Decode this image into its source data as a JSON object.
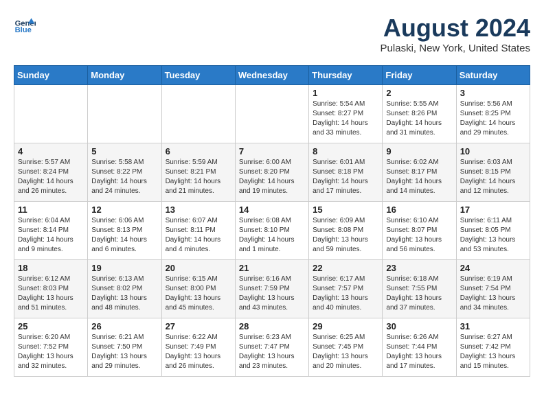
{
  "header": {
    "logo_line1": "General",
    "logo_line2": "Blue",
    "month": "August 2024",
    "location": "Pulaski, New York, United States"
  },
  "days_of_week": [
    "Sunday",
    "Monday",
    "Tuesday",
    "Wednesday",
    "Thursday",
    "Friday",
    "Saturday"
  ],
  "weeks": [
    [
      {
        "day": "",
        "content": ""
      },
      {
        "day": "",
        "content": ""
      },
      {
        "day": "",
        "content": ""
      },
      {
        "day": "",
        "content": ""
      },
      {
        "day": "1",
        "content": "Sunrise: 5:54 AM\nSunset: 8:27 PM\nDaylight: 14 hours\nand 33 minutes."
      },
      {
        "day": "2",
        "content": "Sunrise: 5:55 AM\nSunset: 8:26 PM\nDaylight: 14 hours\nand 31 minutes."
      },
      {
        "day": "3",
        "content": "Sunrise: 5:56 AM\nSunset: 8:25 PM\nDaylight: 14 hours\nand 29 minutes."
      }
    ],
    [
      {
        "day": "4",
        "content": "Sunrise: 5:57 AM\nSunset: 8:24 PM\nDaylight: 14 hours\nand 26 minutes."
      },
      {
        "day": "5",
        "content": "Sunrise: 5:58 AM\nSunset: 8:22 PM\nDaylight: 14 hours\nand 24 minutes."
      },
      {
        "day": "6",
        "content": "Sunrise: 5:59 AM\nSunset: 8:21 PM\nDaylight: 14 hours\nand 21 minutes."
      },
      {
        "day": "7",
        "content": "Sunrise: 6:00 AM\nSunset: 8:20 PM\nDaylight: 14 hours\nand 19 minutes."
      },
      {
        "day": "8",
        "content": "Sunrise: 6:01 AM\nSunset: 8:18 PM\nDaylight: 14 hours\nand 17 minutes."
      },
      {
        "day": "9",
        "content": "Sunrise: 6:02 AM\nSunset: 8:17 PM\nDaylight: 14 hours\nand 14 minutes."
      },
      {
        "day": "10",
        "content": "Sunrise: 6:03 AM\nSunset: 8:15 PM\nDaylight: 14 hours\nand 12 minutes."
      }
    ],
    [
      {
        "day": "11",
        "content": "Sunrise: 6:04 AM\nSunset: 8:14 PM\nDaylight: 14 hours\nand 9 minutes."
      },
      {
        "day": "12",
        "content": "Sunrise: 6:06 AM\nSunset: 8:13 PM\nDaylight: 14 hours\nand 6 minutes."
      },
      {
        "day": "13",
        "content": "Sunrise: 6:07 AM\nSunset: 8:11 PM\nDaylight: 14 hours\nand 4 minutes."
      },
      {
        "day": "14",
        "content": "Sunrise: 6:08 AM\nSunset: 8:10 PM\nDaylight: 14 hours\nand 1 minute."
      },
      {
        "day": "15",
        "content": "Sunrise: 6:09 AM\nSunset: 8:08 PM\nDaylight: 13 hours\nand 59 minutes."
      },
      {
        "day": "16",
        "content": "Sunrise: 6:10 AM\nSunset: 8:07 PM\nDaylight: 13 hours\nand 56 minutes."
      },
      {
        "day": "17",
        "content": "Sunrise: 6:11 AM\nSunset: 8:05 PM\nDaylight: 13 hours\nand 53 minutes."
      }
    ],
    [
      {
        "day": "18",
        "content": "Sunrise: 6:12 AM\nSunset: 8:03 PM\nDaylight: 13 hours\nand 51 minutes."
      },
      {
        "day": "19",
        "content": "Sunrise: 6:13 AM\nSunset: 8:02 PM\nDaylight: 13 hours\nand 48 minutes."
      },
      {
        "day": "20",
        "content": "Sunrise: 6:15 AM\nSunset: 8:00 PM\nDaylight: 13 hours\nand 45 minutes."
      },
      {
        "day": "21",
        "content": "Sunrise: 6:16 AM\nSunset: 7:59 PM\nDaylight: 13 hours\nand 43 minutes."
      },
      {
        "day": "22",
        "content": "Sunrise: 6:17 AM\nSunset: 7:57 PM\nDaylight: 13 hours\nand 40 minutes."
      },
      {
        "day": "23",
        "content": "Sunrise: 6:18 AM\nSunset: 7:55 PM\nDaylight: 13 hours\nand 37 minutes."
      },
      {
        "day": "24",
        "content": "Sunrise: 6:19 AM\nSunset: 7:54 PM\nDaylight: 13 hours\nand 34 minutes."
      }
    ],
    [
      {
        "day": "25",
        "content": "Sunrise: 6:20 AM\nSunset: 7:52 PM\nDaylight: 13 hours\nand 32 minutes."
      },
      {
        "day": "26",
        "content": "Sunrise: 6:21 AM\nSunset: 7:50 PM\nDaylight: 13 hours\nand 29 minutes."
      },
      {
        "day": "27",
        "content": "Sunrise: 6:22 AM\nSunset: 7:49 PM\nDaylight: 13 hours\nand 26 minutes."
      },
      {
        "day": "28",
        "content": "Sunrise: 6:23 AM\nSunset: 7:47 PM\nDaylight: 13 hours\nand 23 minutes."
      },
      {
        "day": "29",
        "content": "Sunrise: 6:25 AM\nSunset: 7:45 PM\nDaylight: 13 hours\nand 20 minutes."
      },
      {
        "day": "30",
        "content": "Sunrise: 6:26 AM\nSunset: 7:44 PM\nDaylight: 13 hours\nand 17 minutes."
      },
      {
        "day": "31",
        "content": "Sunrise: 6:27 AM\nSunset: 7:42 PM\nDaylight: 13 hours\nand 15 minutes."
      }
    ]
  ]
}
